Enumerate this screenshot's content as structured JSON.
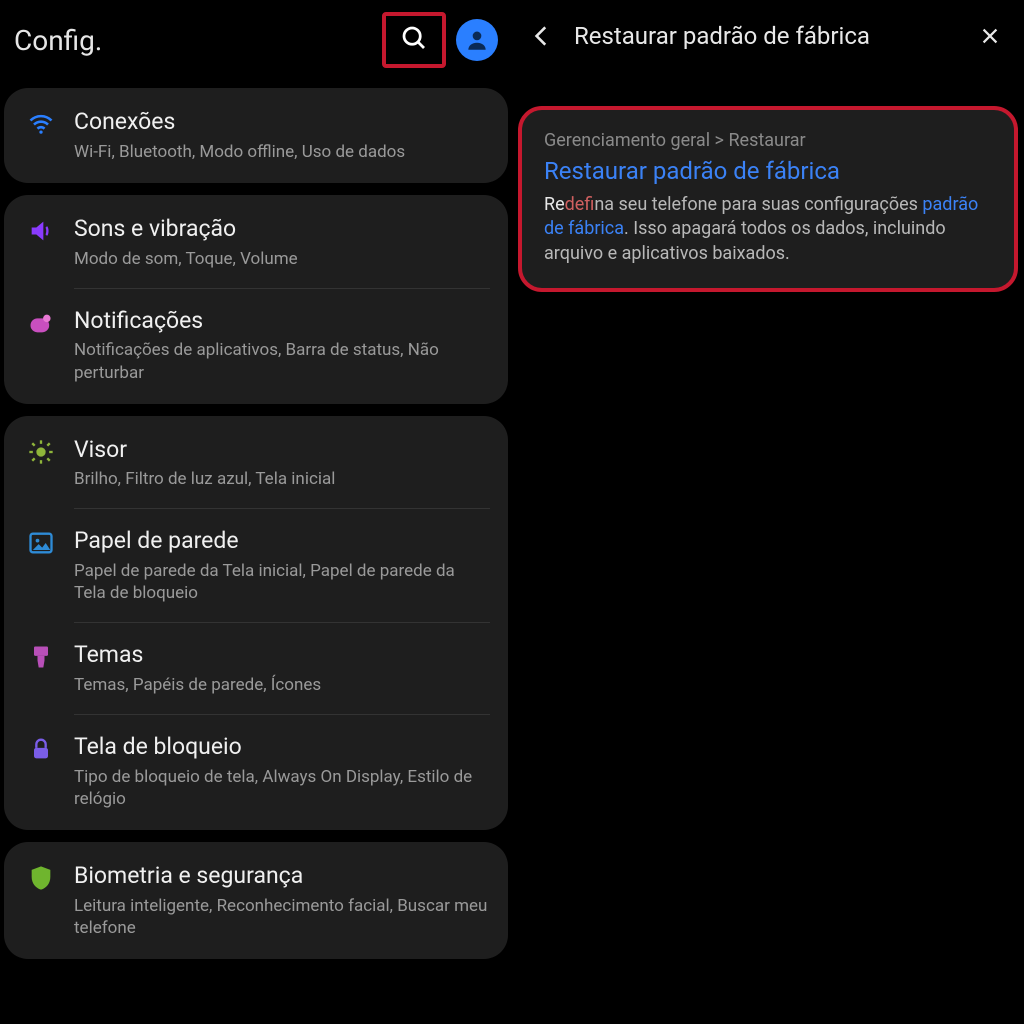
{
  "left": {
    "title": "Config.",
    "groups": [
      {
        "items": [
          {
            "icon": "wifi",
            "color": "#2a7fff",
            "title": "Conexões",
            "sub": "Wi-Fi, Bluetooth, Modo offline, Uso de dados"
          }
        ]
      },
      {
        "items": [
          {
            "icon": "sound",
            "color": "#8a3bff",
            "title": "Sons e vibração",
            "sub": "Modo de som, Toque, Volume"
          },
          {
            "icon": "notify",
            "color": "#c94fbf",
            "title": "Notificações",
            "sub": "Notificações de aplicativos, Barra de status, Não perturbar"
          }
        ]
      },
      {
        "items": [
          {
            "icon": "brightness",
            "color": "#8fb53a",
            "title": "Visor",
            "sub": "Brilho, Filtro de luz azul, Tela inicial"
          },
          {
            "icon": "wallpaper",
            "color": "#2e8bd6",
            "title": "Papel de parede",
            "sub": "Papel de parede da Tela inicial, Papel de parede da Tela de bloqueio"
          },
          {
            "icon": "themes",
            "color": "#b84fb8",
            "title": "Temas",
            "sub": "Temas, Papéis de parede, Ícones"
          },
          {
            "icon": "lock",
            "color": "#7a5de8",
            "title": "Tela de bloqueio",
            "sub": "Tipo de bloqueio de tela, Always On Display, Estilo de relógio"
          }
        ]
      },
      {
        "items": [
          {
            "icon": "shield",
            "color": "#6fb52e",
            "title": "Biometria e segurança",
            "sub": "Leitura inteligente, Reconhecimento facial, Buscar meu telefone"
          }
        ]
      }
    ]
  },
  "right": {
    "query": "Restaurar padrão de fábrica",
    "result": {
      "breadcrumb": "Gerenciamento geral > Restaurar",
      "title": "Restaurar padrão de fábrica",
      "body_pre_hl": "Re",
      "body_hl": "def",
      "body_mid": "ina seu telefone para suas configurações ",
      "body_link": "padrão de fábrica",
      "body_post": ". Isso apagará todos os dados, incluindo arquivo e aplicativos baixados."
    }
  }
}
